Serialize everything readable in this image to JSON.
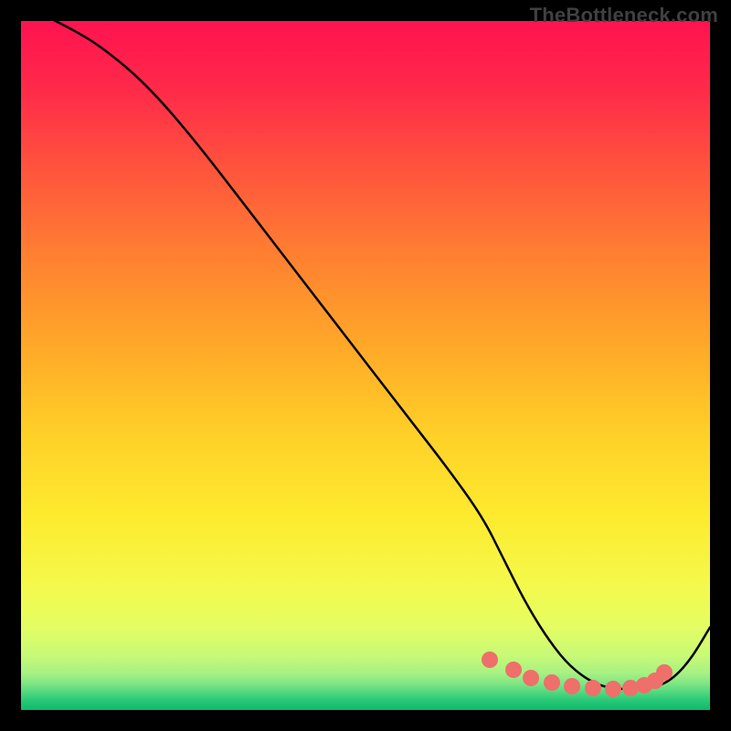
{
  "watermark": "TheBottleneck.com",
  "chart_data": {
    "type": "line",
    "title": "",
    "xlabel": "",
    "ylabel": "",
    "xlim": [
      0,
      100
    ],
    "ylim": [
      0,
      100
    ],
    "series": [
      {
        "name": "curve",
        "x": [
          0,
          3,
          8,
          12,
          18,
          25,
          35,
          45,
          55,
          62,
          67,
          70,
          73,
          76,
          79,
          82,
          85,
          88,
          91,
          94,
          97,
          100
        ],
        "y": [
          103,
          101,
          98.5,
          96,
          91,
          83,
          70,
          57,
          44,
          35,
          28,
          22,
          16,
          11,
          7,
          4.5,
          3.2,
          3.0,
          3.1,
          4.0,
          7,
          12
        ]
      }
    ],
    "markers": {
      "name": "dots",
      "x": [
        68,
        71.5,
        74,
        77,
        80,
        83,
        86,
        88.5,
        90.5,
        92,
        93.3
      ],
      "y": [
        7.3,
        5.8,
        4.7,
        4.0,
        3.5,
        3.2,
        3.1,
        3.2,
        3.6,
        4.2,
        5.5
      ]
    },
    "gradient_stops": [
      {
        "pos": 0.0,
        "color": "#ff1350"
      },
      {
        "pos": 0.1,
        "color": "#ff2a49"
      },
      {
        "pos": 0.22,
        "color": "#ff563c"
      },
      {
        "pos": 0.35,
        "color": "#ff8330"
      },
      {
        "pos": 0.48,
        "color": "#ffab28"
      },
      {
        "pos": 0.6,
        "color": "#ffd028"
      },
      {
        "pos": 0.72,
        "color": "#fdeb2e"
      },
      {
        "pos": 0.82,
        "color": "#f4f94c"
      },
      {
        "pos": 0.88,
        "color": "#e4fd63"
      },
      {
        "pos": 0.92,
        "color": "#c8fa76"
      },
      {
        "pos": 0.946,
        "color": "#a8f182"
      },
      {
        "pos": 0.962,
        "color": "#7de584"
      },
      {
        "pos": 0.975,
        "color": "#4fd77f"
      },
      {
        "pos": 0.987,
        "color": "#26c876"
      },
      {
        "pos": 1.0,
        "color": "#0dba6e"
      }
    ]
  }
}
